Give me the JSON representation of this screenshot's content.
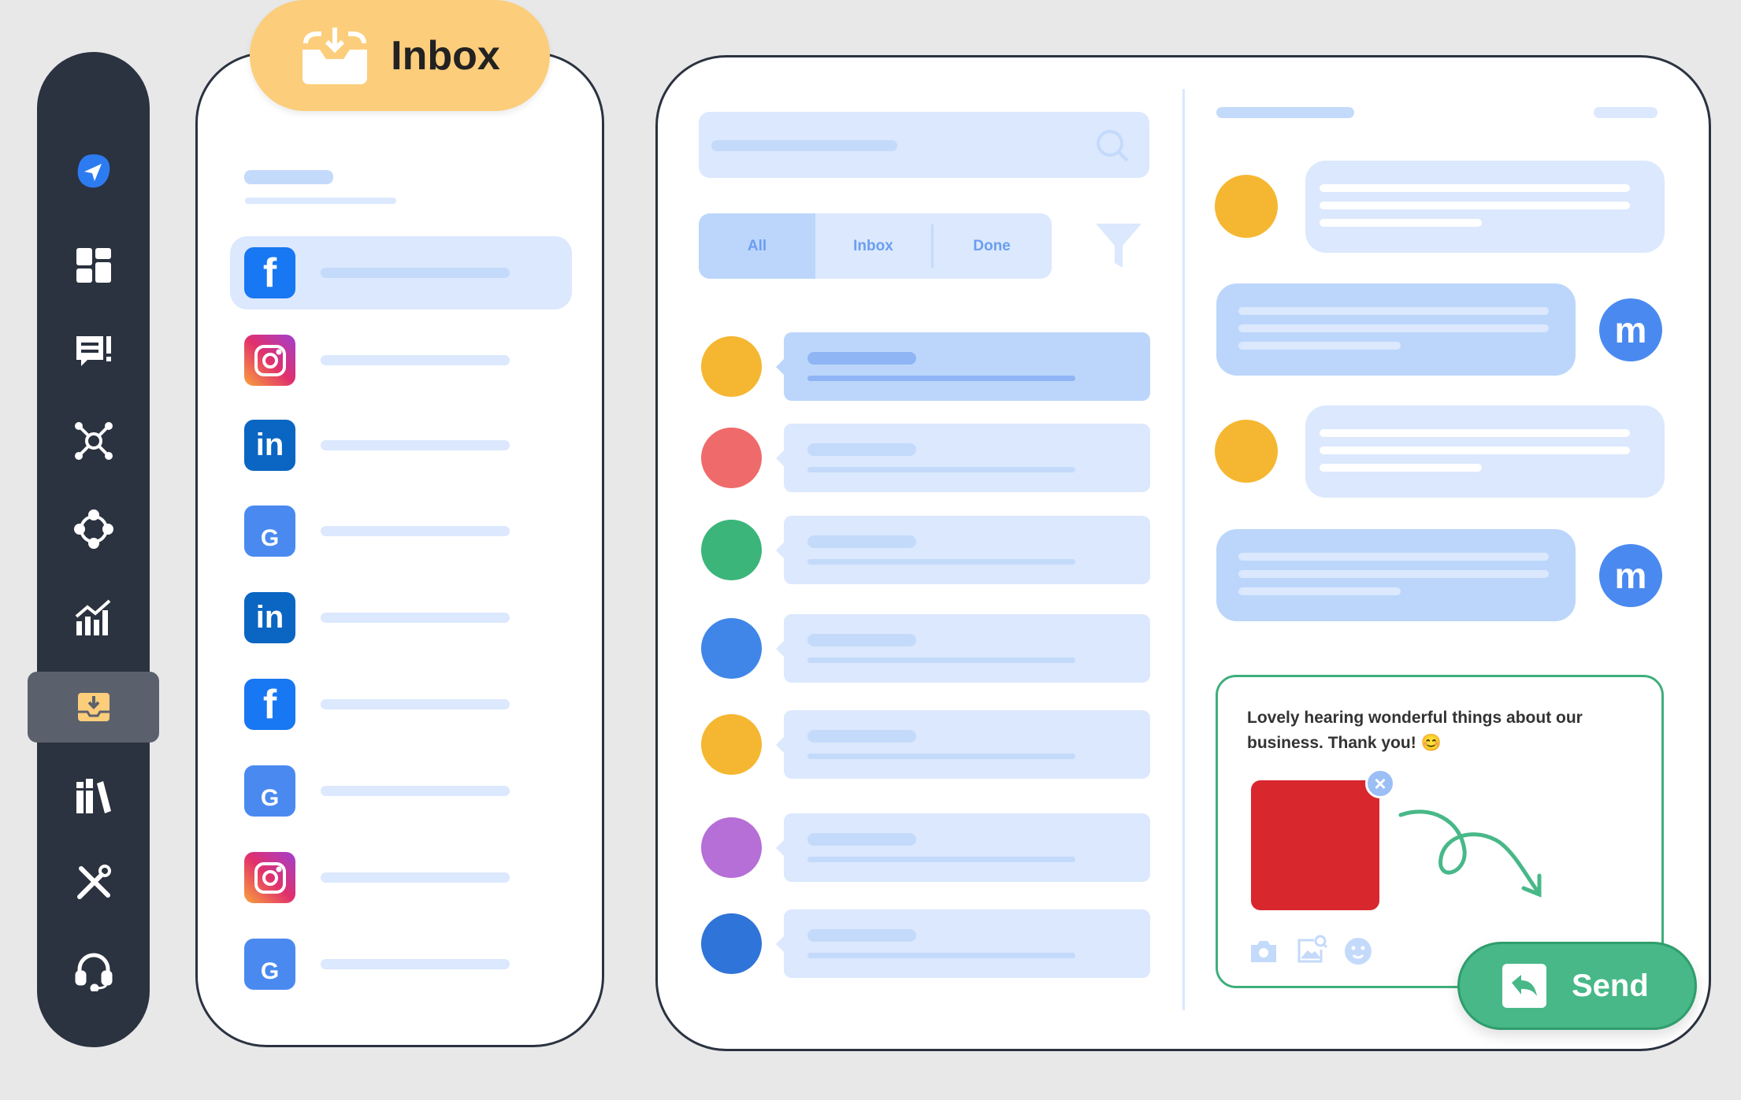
{
  "badge": {
    "title": "Inbox",
    "icon": "inbox-tray-icon",
    "color": "#fccd7b"
  },
  "sidebar": {
    "items": [
      {
        "icon": "paper-plane-logo-icon"
      },
      {
        "icon": "dashboard-grid-icon"
      },
      {
        "icon": "chat-alert-icon"
      },
      {
        "icon": "network-nodes-icon"
      },
      {
        "icon": "cycle-icon"
      },
      {
        "icon": "analytics-chart-icon"
      },
      {
        "icon": "inbox-icon",
        "active": true
      },
      {
        "icon": "library-books-icon"
      },
      {
        "icon": "tools-icon"
      },
      {
        "icon": "headset-support-icon"
      }
    ]
  },
  "channels": [
    {
      "network": "facebook",
      "selected": true
    },
    {
      "network": "instagram"
    },
    {
      "network": "linkedin"
    },
    {
      "network": "google-business"
    },
    {
      "network": "linkedin"
    },
    {
      "network": "facebook"
    },
    {
      "network": "google-business"
    },
    {
      "network": "instagram"
    },
    {
      "network": "google-business"
    }
  ],
  "filters": {
    "tabs": [
      "All",
      "Inbox",
      "Done"
    ],
    "active": "All"
  },
  "compose": {
    "message": "Lovely hearing wonderful things about our business. Thank you! 😊",
    "send_label": "Send"
  },
  "colors": {
    "sidebar": "#2b3240",
    "accent_blue": "#4a8af0",
    "send_green": "#48b888",
    "placeholder": "#dbe8fd"
  }
}
